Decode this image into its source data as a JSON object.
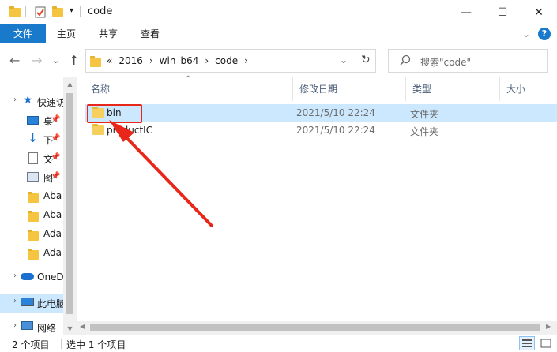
{
  "window": {
    "title": "code",
    "minimize": "—",
    "maximize": "☐",
    "close": "✕"
  },
  "ribbon": {
    "tabs": [
      "文件",
      "主页",
      "共享",
      "查看"
    ],
    "expand": "⌄",
    "help": "?"
  },
  "nav": {
    "back": "←",
    "forward": "→",
    "recent": "⌄",
    "up": "↑",
    "overflow": "«",
    "crumbs": [
      "2016",
      "win_b64",
      "code"
    ],
    "crumb_sep": "›",
    "refresh": "↻",
    "addr_dropdown": "⌄",
    "search_placeholder": "搜索\"code\""
  },
  "sidebar": {
    "items": [
      {
        "label": "快速访",
        "icon": "star-icon"
      },
      {
        "label": "桌",
        "icon": "desktop-icon"
      },
      {
        "label": "下",
        "icon": "download-icon"
      },
      {
        "label": "文",
        "icon": "document-icon"
      },
      {
        "label": "图",
        "icon": "picture-icon"
      },
      {
        "label": "Aba",
        "icon": "folder-icon"
      },
      {
        "label": "Aba",
        "icon": "folder-icon"
      },
      {
        "label": "Ada",
        "icon": "folder-icon"
      },
      {
        "label": "Ada",
        "icon": "folder-icon"
      },
      {
        "label": "OneD",
        "icon": "cloud-icon"
      },
      {
        "label": "此电脑",
        "icon": "computer-icon"
      },
      {
        "label": "网络",
        "icon": "network-icon"
      }
    ]
  },
  "columns": {
    "name": "名称",
    "date": "修改日期",
    "type": "类型",
    "size": "大小"
  },
  "files": [
    {
      "name": "bin",
      "date": "2021/5/10 22:24",
      "type": "文件夹",
      "selected": true
    },
    {
      "name": "productIC",
      "date": "2021/5/10 22:24",
      "type": "文件夹",
      "selected": false
    }
  ],
  "status": {
    "count": "2 个项目",
    "selected": "选中 1 个项目"
  },
  "colors": {
    "accent": "#1979ca",
    "selection": "#cce8ff",
    "annotation": "#e8271a"
  }
}
